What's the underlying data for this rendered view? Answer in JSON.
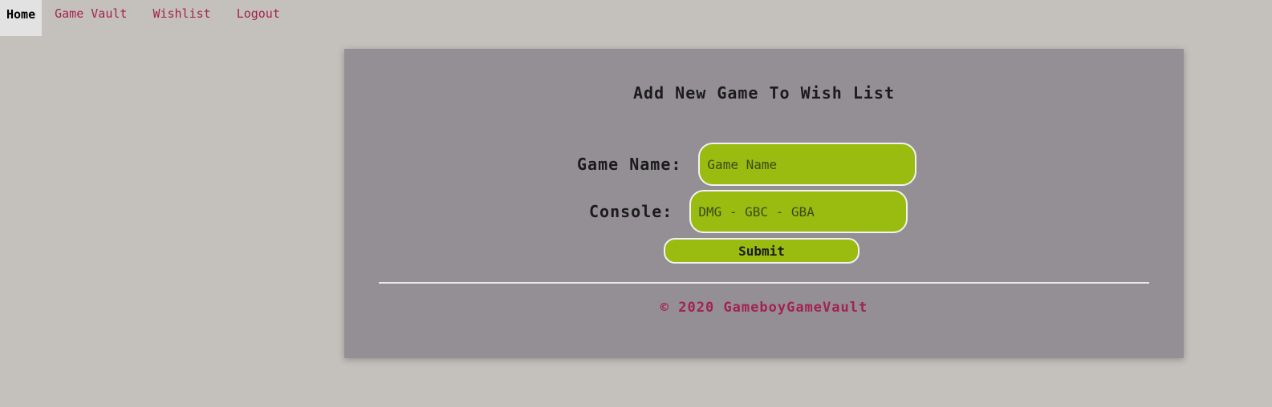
{
  "nav": {
    "items": [
      {
        "label": "Home",
        "active": true
      },
      {
        "label": "Game Vault",
        "active": false
      },
      {
        "label": "Wishlist",
        "active": false
      },
      {
        "label": "Logout",
        "active": false
      }
    ]
  },
  "form": {
    "title": "Add New Game To Wish List",
    "game_name_label": "Game Name:",
    "game_name_placeholder": "Game Name",
    "console_label": "Console:",
    "console_placeholder": "DMG - GBC - GBA",
    "submit_label": "Submit"
  },
  "footer": {
    "text": "© 2020 GameboyGameVault"
  },
  "colors": {
    "page_bg": "#c4c1bc",
    "card_bg": "#948f95",
    "accent_green": "#9abb0f",
    "link_color": "#a3224f",
    "active_nav_bg": "#e2e2e2"
  }
}
